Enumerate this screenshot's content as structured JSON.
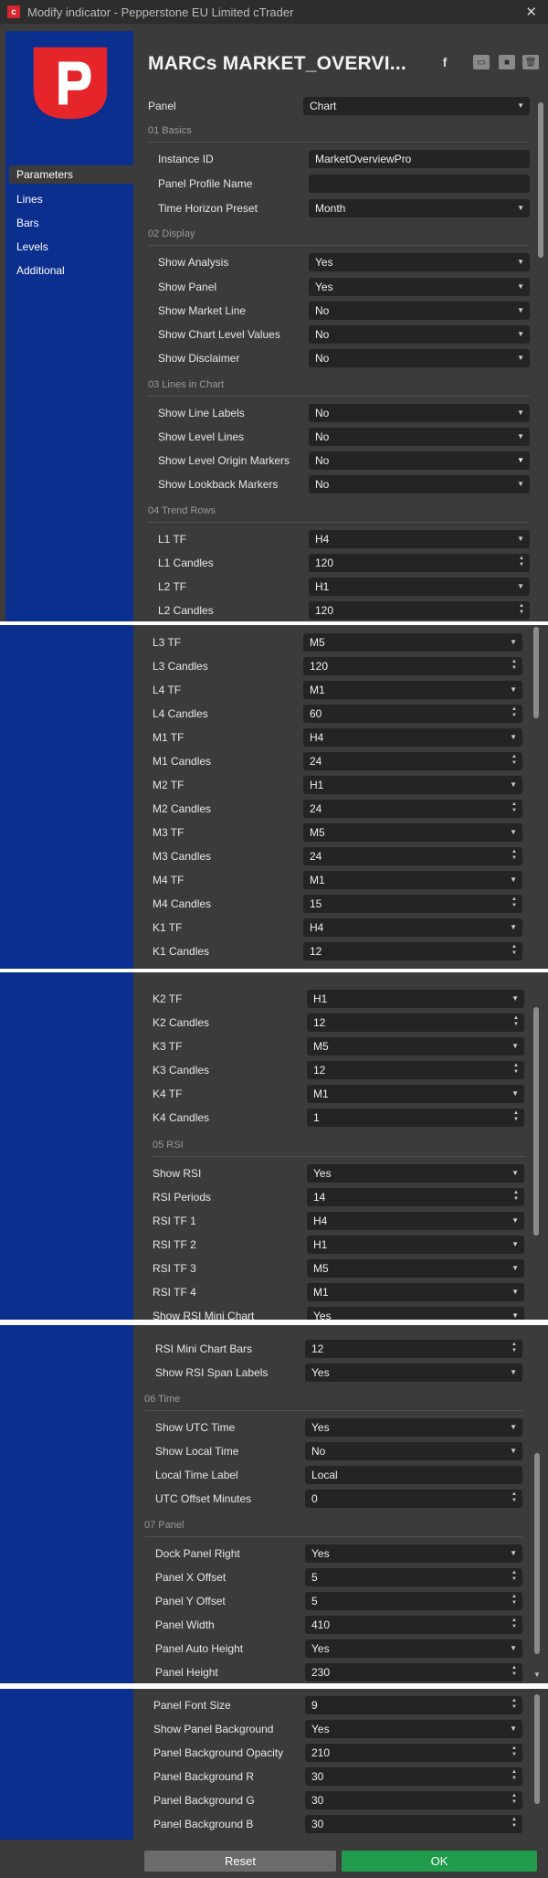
{
  "window": {
    "title": "Modify indicator - Pepperstone EU Limited cTrader",
    "close": "✕"
  },
  "header": {
    "title": "MARCs MARKET_OVERVI..."
  },
  "nav": [
    "Parameters",
    "Lines",
    "Bars",
    "Levels",
    "Additional"
  ],
  "panel1": {
    "top": {
      "label": "Panel",
      "value": "Chart"
    },
    "sections": [
      "01 Basics",
      "02 Display",
      "03 Lines in Chart",
      "04 Trend Rows"
    ],
    "rows": [
      {
        "label": "Instance ID",
        "value": "MarketOverviewPro"
      },
      {
        "label": "Panel Profile Name",
        "value": ""
      },
      {
        "label": "Time Horizon Preset",
        "value": "Month"
      },
      {
        "label": "Show Analysis",
        "value": "Yes"
      },
      {
        "label": "Show Panel",
        "value": "Yes"
      },
      {
        "label": "Show Market Line",
        "value": "No"
      },
      {
        "label": "Show Chart Level Values",
        "value": "No"
      },
      {
        "label": "Show Disclaimer",
        "value": "No"
      },
      {
        "label": "Show Line Labels",
        "value": "No"
      },
      {
        "label": "Show Level Lines",
        "value": "No"
      },
      {
        "label": "Show Level Origin Markers",
        "value": "No"
      },
      {
        "label": "Show Lookback Markers",
        "value": "No"
      },
      {
        "label": "L1 TF",
        "value": "H4"
      },
      {
        "label": "L1 Candles",
        "value": "120"
      },
      {
        "label": "L2 TF",
        "value": "H1"
      },
      {
        "label": "L2 Candles",
        "value": "120"
      }
    ]
  },
  "panel2": {
    "rows": [
      {
        "label": "L3 TF",
        "value": "M5"
      },
      {
        "label": "L3 Candles",
        "value": "120"
      },
      {
        "label": "L4 TF",
        "value": "M1"
      },
      {
        "label": "L4 Candles",
        "value": "60"
      },
      {
        "label": "M1 TF",
        "value": "H4"
      },
      {
        "label": "M1 Candles",
        "value": "24"
      },
      {
        "label": "M2 TF",
        "value": "H1"
      },
      {
        "label": "M2 Candles",
        "value": "24"
      },
      {
        "label": "M3 TF",
        "value": "M5"
      },
      {
        "label": "M3 Candles",
        "value": "24"
      },
      {
        "label": "M4 TF",
        "value": "M1"
      },
      {
        "label": "M4 Candles",
        "value": "15"
      },
      {
        "label": "K1 TF",
        "value": "H4"
      },
      {
        "label": "K1 Candles",
        "value": "12"
      }
    ]
  },
  "panel3": {
    "section": "05 RSI",
    "rows": [
      {
        "label": "K2 TF",
        "value": "H1"
      },
      {
        "label": "K2 Candles",
        "value": "12"
      },
      {
        "label": "K3 TF",
        "value": "M5"
      },
      {
        "label": "K3 Candles",
        "value": "12"
      },
      {
        "label": "K4 TF",
        "value": "M1"
      },
      {
        "label": "K4 Candles",
        "value": "1"
      },
      {
        "label": "Show RSI",
        "value": "Yes"
      },
      {
        "label": "RSI Periods",
        "value": "14"
      },
      {
        "label": "RSI TF 1",
        "value": "H4"
      },
      {
        "label": "RSI TF 2",
        "value": "H1"
      },
      {
        "label": "RSI TF 3",
        "value": "M5"
      },
      {
        "label": "RSI TF 4",
        "value": "M1"
      },
      {
        "label": "Show RSI Mini Chart",
        "value": "Yes"
      }
    ]
  },
  "panel4": {
    "sections": [
      "06 Time",
      "07 Panel"
    ],
    "rows": [
      {
        "label": "RSI Mini Chart Bars",
        "value": "12"
      },
      {
        "label": "Show RSI Span Labels",
        "value": "Yes"
      },
      {
        "label": "Show UTC Time",
        "value": "Yes"
      },
      {
        "label": "Show Local Time",
        "value": "No"
      },
      {
        "label": "Local Time Label",
        "value": "Local"
      },
      {
        "label": "UTC Offset Minutes",
        "value": "0"
      },
      {
        "label": "Dock Panel Right",
        "value": "Yes"
      },
      {
        "label": "Panel X Offset",
        "value": "5"
      },
      {
        "label": "Panel Y Offset",
        "value": "5"
      },
      {
        "label": "Panel Width",
        "value": "410"
      },
      {
        "label": "Panel Auto Height",
        "value": "Yes"
      },
      {
        "label": "Panel Height",
        "value": "230"
      }
    ]
  },
  "panel5": {
    "rows": [
      {
        "label": "Panel Font Size",
        "value": "9"
      },
      {
        "label": "Show Panel Background",
        "value": "Yes"
      },
      {
        "label": "Panel Background Opacity",
        "value": "210"
      },
      {
        "label": "Panel Background R",
        "value": "30"
      },
      {
        "label": "Panel Background G",
        "value": "30"
      },
      {
        "label": "Panel Background B",
        "value": "30"
      }
    ],
    "reset": "Reset",
    "ok": "OK"
  },
  "colors": {
    "accent_ok": "#1f9b4b",
    "sidebar": "#0b2f8f",
    "logo": "#e5252a"
  }
}
